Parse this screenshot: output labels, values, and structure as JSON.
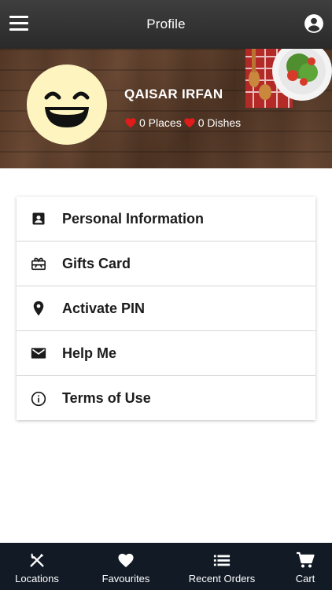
{
  "appbar": {
    "title": "Profile",
    "menu_icon": "hamburger-icon",
    "account_icon": "account-circle-icon"
  },
  "profile": {
    "name": "QAISAR IRFAN",
    "places_label": "0 Places",
    "dishes_label": "0 Dishes",
    "avatar_icon": "grinning-face-icon",
    "heart_color": "#e01b1b",
    "avatar_color": "#fdf4c0"
  },
  "menu": {
    "items": [
      {
        "label": "Personal Information",
        "icon": "contact-card-icon"
      },
      {
        "label": "Gifts Card",
        "icon": "gift-card-icon"
      },
      {
        "label": "Activate PIN",
        "icon": "location-pin-icon"
      },
      {
        "label": "Help Me",
        "icon": "mail-icon"
      },
      {
        "label": "Terms of Use",
        "icon": "info-icon"
      }
    ]
  },
  "bottom_nav": {
    "background": "#111a25",
    "items": [
      {
        "label": "Locations",
        "icon": "fork-knife-icon"
      },
      {
        "label": "Favourites",
        "icon": "heart-icon"
      },
      {
        "label": "Recent Orders",
        "icon": "list-icon"
      },
      {
        "label": "Cart",
        "icon": "cart-icon"
      }
    ]
  }
}
